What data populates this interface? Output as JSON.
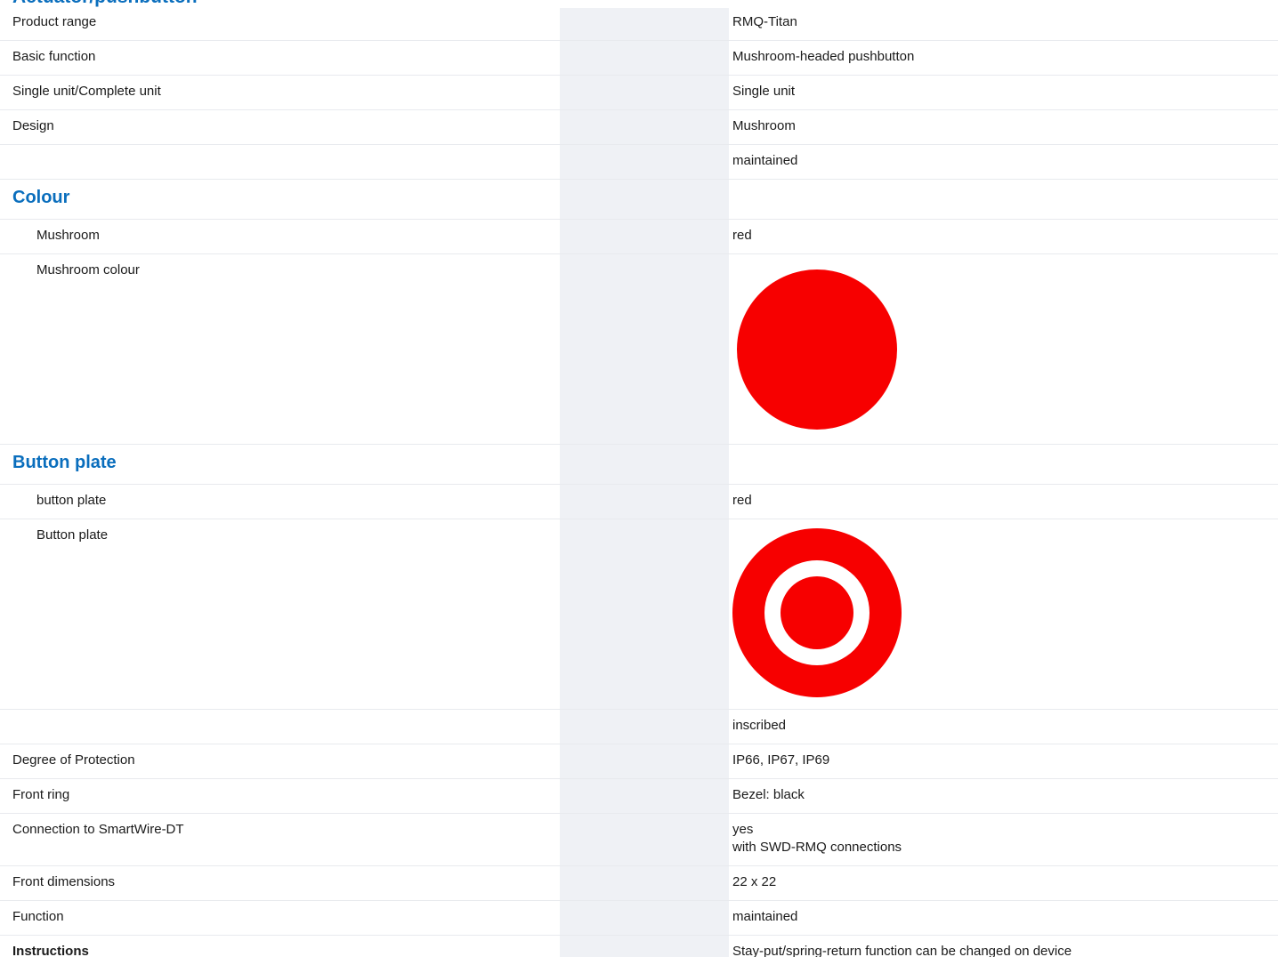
{
  "top_heading": "Actuator/pushbutton",
  "rows": {
    "product_range": {
      "label": "Product range",
      "value": "RMQ-Titan"
    },
    "basic_function": {
      "label": "Basic function",
      "value": "Mushroom-headed pushbutton"
    },
    "single_complete": {
      "label": "Single unit/Complete unit",
      "value": "Single unit"
    },
    "design": {
      "label": "Design",
      "value": "Mushroom"
    },
    "design_extra": {
      "label": "",
      "value": "maintained"
    },
    "colour_section": {
      "label": "Colour"
    },
    "mushroom": {
      "label": "Mushroom",
      "value": "red"
    },
    "mushroom_colour": {
      "label": "Mushroom colour",
      "swatch_color": "#f70000",
      "swatch_icon": "red-circle-icon"
    },
    "button_plate_section": {
      "label": "Button plate"
    },
    "button_plate_lower": {
      "label": "button plate",
      "value": "red"
    },
    "button_plate_img": {
      "label": "Button plate",
      "swatch_color": "#f70000",
      "swatch_icon": "red-ring-target-icon"
    },
    "inscribed": {
      "label": "",
      "value": "inscribed"
    },
    "degree_protection": {
      "label": "Degree of Protection",
      "value": "IP66, IP67, IP69"
    },
    "front_ring": {
      "label": "Front ring",
      "value": "Bezel: black"
    },
    "smartwire": {
      "label": "Connection to SmartWire-DT",
      "value_line1": "yes",
      "value_line2": "with SWD-RMQ connections"
    },
    "front_dimensions": {
      "label": "Front dimensions",
      "value": "22 x 22"
    },
    "function": {
      "label": "Function",
      "value": "maintained"
    },
    "instructions": {
      "label": "Instructions",
      "value": "Stay-put/spring-return function can be changed on device"
    }
  },
  "colors": {
    "section_heading": "#0a6ebd",
    "band": "#eff1f5",
    "swatch_red": "#f70000"
  }
}
